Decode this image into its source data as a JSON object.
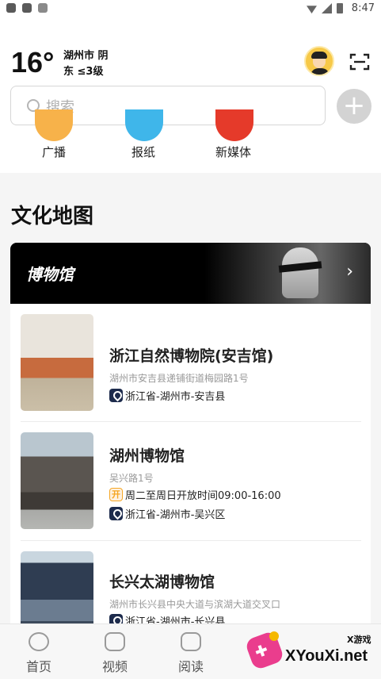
{
  "status_bar": {
    "time": "8:47",
    "left_icons": [
      "app-icon",
      "app-icon",
      "a-icon"
    ],
    "right_icons": [
      "wifi-icon",
      "signal-icon",
      "battery-icon"
    ]
  },
  "weather": {
    "temperature": "16°",
    "line1": "湖州市 阴",
    "line2": "东 ≤3级"
  },
  "search": {
    "placeholder": "搜索"
  },
  "categories": [
    {
      "label": "广播",
      "color": "#f7b24a"
    },
    {
      "label": "报纸",
      "color": "#3fb6ea"
    },
    {
      "label": "新媒体",
      "color": "#e53a2a"
    }
  ],
  "section_title": "文化地图",
  "banner": {
    "title": "博物馆"
  },
  "museums": [
    {
      "name": "浙江自然博物院(安吉馆)",
      "address": "湖州市安吉县递铺街道梅园路1号",
      "hours": "",
      "region": "浙江省-湖州市-安吉县"
    },
    {
      "name": "湖州博物馆",
      "address": "吴兴路1号",
      "hours_badge": "开",
      "hours": "周二至周日开放时间09:00-16:00",
      "region": "浙江省-湖州市-吴兴区"
    },
    {
      "name": "长兴太湖博物馆",
      "address": "湖州市长兴县中央大道与滨湖大道交叉口",
      "hours": "",
      "region": "浙江省-湖州市-长兴县"
    }
  ],
  "tabs": [
    {
      "label": "首页"
    },
    {
      "label": "视频"
    },
    {
      "label": "阅读"
    }
  ],
  "watermark": {
    "small": "X游戏",
    "big": "XYouXi.net"
  }
}
